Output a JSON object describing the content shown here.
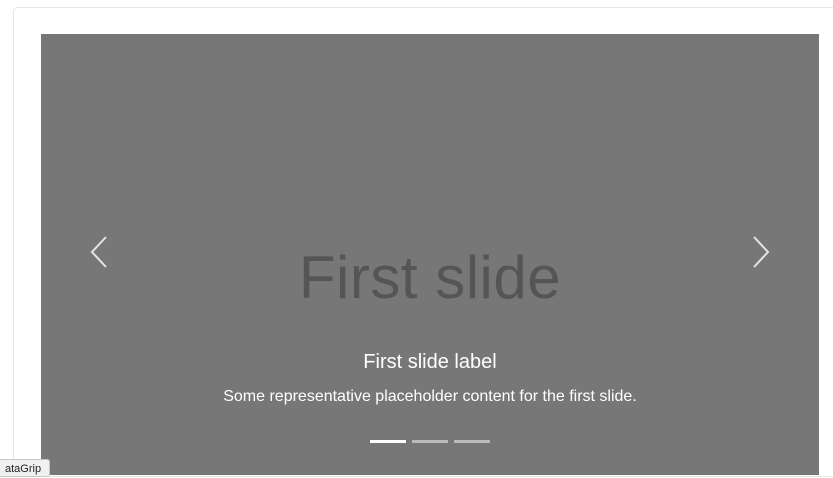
{
  "carousel": {
    "placeholder_text": "First slide",
    "prev_label": "Previous",
    "next_label": "Next",
    "caption_title": "First slide label",
    "caption_text": "Some representative placeholder content for the first slide.",
    "indicators": [
      {
        "label": "Slide 1",
        "active": true
      },
      {
        "label": "Slide 2",
        "active": false
      },
      {
        "label": "Slide 3",
        "active": false
      }
    ],
    "background_color": "#777777",
    "placeholder_color": "#555555"
  },
  "tooltip": {
    "text": "ataGrip"
  }
}
